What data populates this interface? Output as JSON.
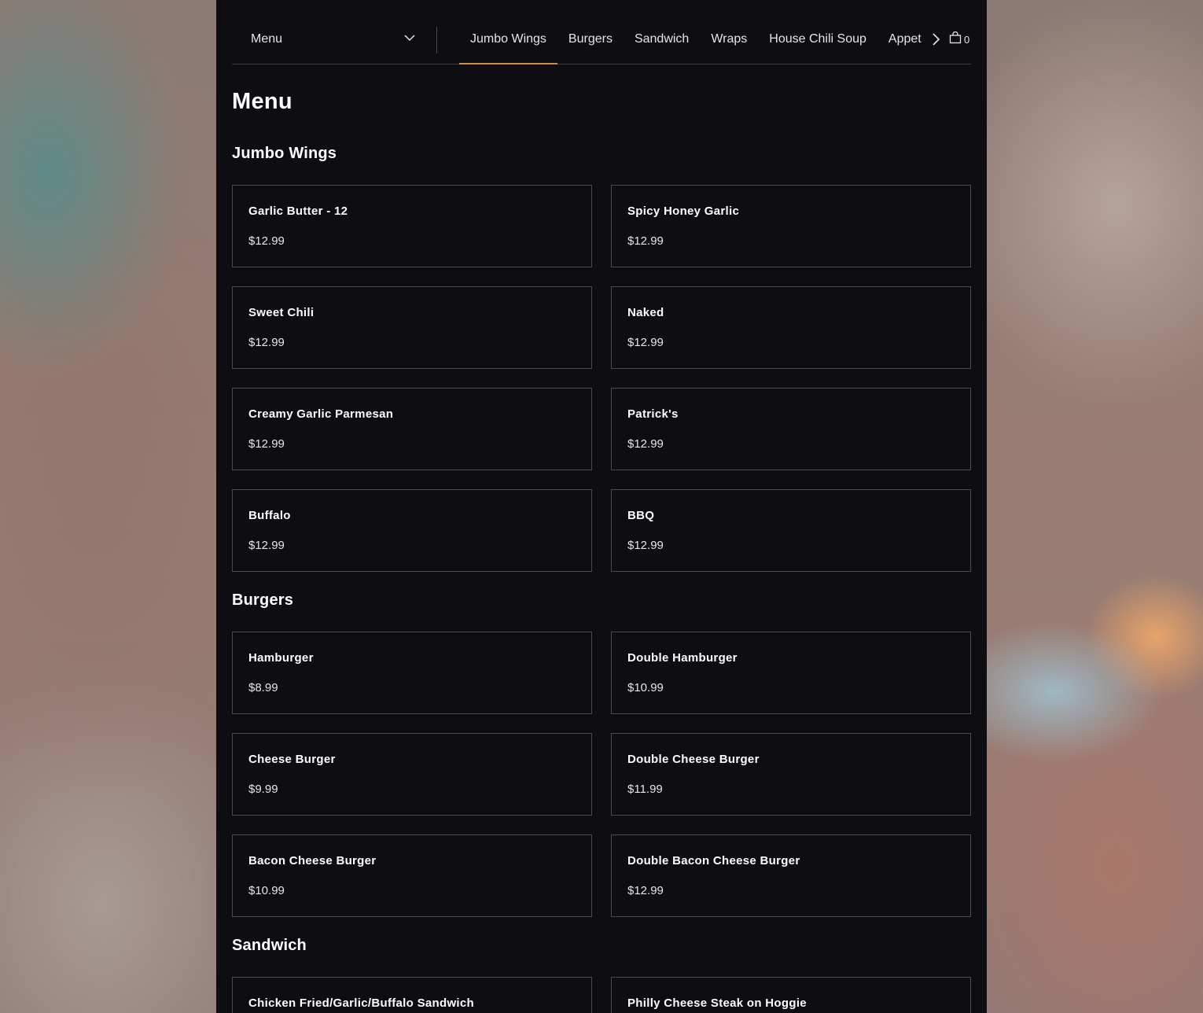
{
  "header": {
    "menu_select": "Menu",
    "tabs": [
      "Jumbo Wings",
      "Burgers",
      "Sandwich",
      "Wraps",
      "House Chili Soup",
      "Appet"
    ],
    "cart_count": "0"
  },
  "page_title": "Menu",
  "sections": [
    {
      "title": "Jumbo Wings",
      "items": [
        {
          "name": "Garlic Butter - 12",
          "price": "$12.99"
        },
        {
          "name": "Spicy Honey Garlic",
          "price": "$12.99"
        },
        {
          "name": "Sweet Chili",
          "price": "$12.99"
        },
        {
          "name": "Naked",
          "price": "$12.99"
        },
        {
          "name": "Creamy Garlic Parmesan",
          "price": "$12.99"
        },
        {
          "name": "Patrick's",
          "price": "$12.99"
        },
        {
          "name": "Buffalo",
          "price": "$12.99"
        },
        {
          "name": "BBQ",
          "price": "$12.99"
        }
      ]
    },
    {
      "title": "Burgers",
      "items": [
        {
          "name": "Hamburger",
          "price": "$8.99"
        },
        {
          "name": "Double Hamburger",
          "price": "$10.99"
        },
        {
          "name": "Cheese Burger",
          "price": "$9.99"
        },
        {
          "name": "Double Cheese Burger",
          "price": "$11.99"
        },
        {
          "name": "Bacon Cheese Burger",
          "price": "$10.99"
        },
        {
          "name": "Double Bacon Cheese Burger",
          "price": "$12.99"
        }
      ]
    },
    {
      "title": "Sandwich",
      "items": [
        {
          "name": "Chicken Fried/Garlic/Buffalo Sandwich",
          "price": ""
        },
        {
          "name": "Philly Cheese Steak on Hoggie",
          "price": ""
        }
      ]
    }
  ],
  "colors": {
    "panel_bg": "#0d0d12",
    "accent": "#d28a4b",
    "card_border": "#4a4a52"
  }
}
